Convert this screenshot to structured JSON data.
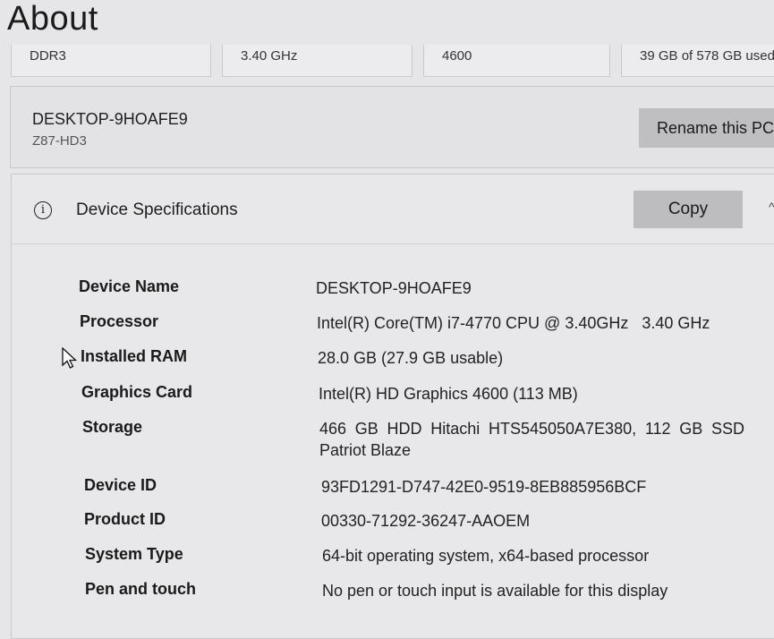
{
  "page": {
    "title": "About"
  },
  "summary": {
    "ram_type": "DDR3",
    "cpu_speed": "3.40 GHz",
    "graphics": "4600",
    "storage_used": "39 GB of 578 GB used"
  },
  "pc": {
    "name": "DESKTOP-9HOAFE9",
    "model": "Z87-HD3",
    "rename_label": "Rename this PC"
  },
  "specs": {
    "title": "Device Specifications",
    "copy_label": "Copy",
    "rows": [
      {
        "label": "Device Name",
        "value": "DESKTOP-9HOAFE9"
      },
      {
        "label": "Processor",
        "value": "Intel(R) Core(TM) i7-4770 CPU @ 3.40GHz   3.40 GHz"
      },
      {
        "label": "Installed RAM",
        "value": "28.0 GB (27.9 GB usable)"
      },
      {
        "label": "Graphics Card",
        "value": "Intel(R) HD Graphics 4600 (113 MB)"
      },
      {
        "label": "Storage",
        "value": "466 GB HDD Hitachi HTS545050A7E380, 112 GB SSD Patriot Blaze"
      },
      {
        "label": "Device ID",
        "value": "93FD1291-D747-42E0-9519-8EB885956BCF"
      },
      {
        "label": "Product ID",
        "value": "00330-71292-36247-AAOEM"
      },
      {
        "label": "System Type",
        "value": "64-bit operating system, x64-based processor"
      },
      {
        "label": "Pen and touch",
        "value": "No pen or touch input is available for this display"
      }
    ]
  },
  "icons": {
    "info": "info-icon",
    "chevron": "chevron-up-icon",
    "cursor": "mouse-cursor-icon"
  }
}
